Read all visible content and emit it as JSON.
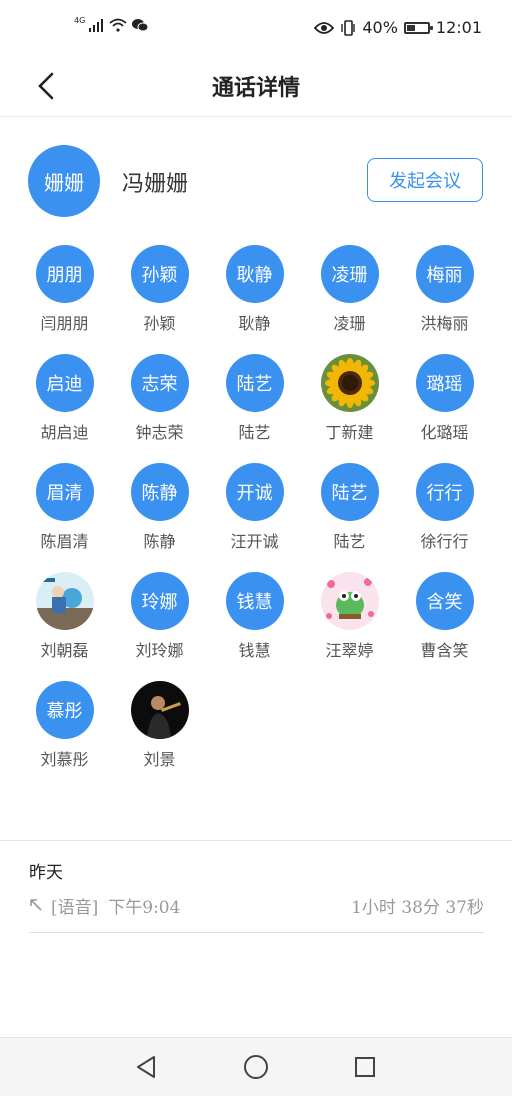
{
  "status_bar": {
    "network": "4G",
    "battery": "40%",
    "battery_level": 0.4,
    "time": "12:01"
  },
  "header": {
    "title": "通话详情"
  },
  "host": {
    "avatar_text": "姗姗",
    "name": "冯姗姗"
  },
  "actions": {
    "start_meeting": "发起会议"
  },
  "members": [
    {
      "avatar_text": "朋朋",
      "name": "闫朋朋"
    },
    {
      "avatar_text": "孙颖",
      "name": "孙颖"
    },
    {
      "avatar_text": "耿静",
      "name": "耿静"
    },
    {
      "avatar_text": "凌珊",
      "name": "凌珊"
    },
    {
      "avatar_text": "梅丽",
      "name": "洪梅丽"
    },
    {
      "avatar_text": "启迪",
      "name": "胡启迪"
    },
    {
      "avatar_text": "志荣",
      "name": "钟志荣"
    },
    {
      "avatar_text": "陆艺",
      "name": "陆艺"
    },
    {
      "avatar_text": "",
      "name": "丁新建",
      "photo": "sunflower"
    },
    {
      "avatar_text": "璐瑶",
      "name": "化璐瑶"
    },
    {
      "avatar_text": "眉清",
      "name": "陈眉清"
    },
    {
      "avatar_text": "陈静",
      "name": "陈静"
    },
    {
      "avatar_text": "开诚",
      "name": "汪开诚"
    },
    {
      "avatar_text": "陆艺",
      "name": "陆艺"
    },
    {
      "avatar_text": "行行",
      "name": "徐行行"
    },
    {
      "avatar_text": "",
      "name": "刘朝磊",
      "photo": "cartoon"
    },
    {
      "avatar_text": "玲娜",
      "name": "刘玲娜"
    },
    {
      "avatar_text": "钱慧",
      "name": "钱慧"
    },
    {
      "avatar_text": "",
      "name": "汪翠婷",
      "photo": "frog"
    },
    {
      "avatar_text": "含笑",
      "name": "曹含笑"
    },
    {
      "avatar_text": "慕彤",
      "name": "刘慕彤"
    },
    {
      "avatar_text": "",
      "name": "刘景",
      "photo": "dark-portrait"
    }
  ],
  "call_log": {
    "day": "昨天",
    "entries": [
      {
        "type": "[语音]",
        "time": "下午9:04",
        "duration": "1小时 38分 37秒"
      }
    ]
  },
  "colors": {
    "accent": "#3a91ef"
  }
}
